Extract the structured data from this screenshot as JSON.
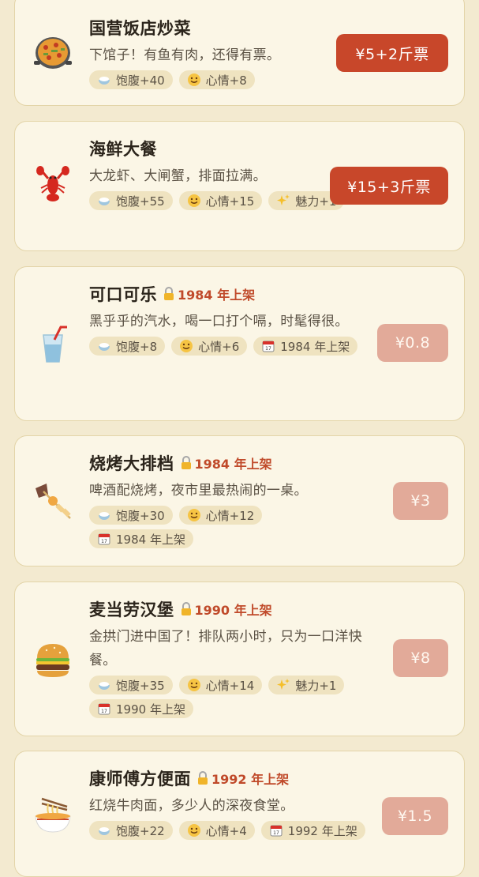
{
  "items": [
    {
      "name": "国营饭店炒菜",
      "icon": "paella-pan-icon",
      "desc": "下馆子！有鱼有肉，还得有票。",
      "tags": [
        {
          "icon": "rice-bowl-icon",
          "text": "饱腹+40"
        },
        {
          "icon": "smile-icon",
          "text": "心情+8"
        }
      ],
      "price": "¥5+2斤票",
      "locked": false
    },
    {
      "name": "海鲜大餐",
      "icon": "lobster-icon",
      "desc": "大龙虾、大闸蟹，排面拉满。",
      "tags": [
        {
          "icon": "rice-bowl-icon",
          "text": "饱腹+55"
        },
        {
          "icon": "smile-icon",
          "text": "心情+15"
        },
        {
          "icon": "sparkles-icon",
          "text": "魅力+1"
        }
      ],
      "price": "¥15+3斤票",
      "locked": false
    },
    {
      "name": "可口可乐",
      "icon": "cup-with-straw-icon",
      "year_tag": "1984 年上架",
      "desc": "黑乎乎的汽水，喝一口打个嗝，时髦得很。",
      "tags": [
        {
          "icon": "rice-bowl-icon",
          "text": "饱腹+8"
        },
        {
          "icon": "smile-icon",
          "text": "心情+6"
        },
        {
          "icon": "calendar-icon",
          "text": "1984 年上架"
        }
      ],
      "price": "¥0.8",
      "locked": true
    },
    {
      "name": "烧烤大排档",
      "icon": "skewer-icon",
      "year_tag": "1984 年上架",
      "desc": "啤酒配烧烤，夜市里最热闹的一桌。",
      "tags": [
        {
          "icon": "rice-bowl-icon",
          "text": "饱腹+30"
        },
        {
          "icon": "smile-icon",
          "text": "心情+12"
        },
        {
          "icon": "calendar-icon",
          "text": "1984 年上架"
        }
      ],
      "price": "¥3",
      "locked": true
    },
    {
      "name": "麦当劳汉堡",
      "icon": "hamburger-icon",
      "year_tag": "1990 年上架",
      "desc": "金拱门进中国了！排队两小时，只为一口洋快餐。",
      "tags": [
        {
          "icon": "rice-bowl-icon",
          "text": "饱腹+35"
        },
        {
          "icon": "smile-icon",
          "text": "心情+14"
        },
        {
          "icon": "sparkles-icon",
          "text": "魅力+1"
        },
        {
          "icon": "calendar-icon",
          "text": "1990 年上架"
        }
      ],
      "price": "¥8",
      "locked": true
    },
    {
      "name": "康师傅方便面",
      "icon": "noodle-bowl-icon",
      "year_tag": "1992 年上架",
      "desc": "红烧牛肉面，多少人的深夜食堂。",
      "tags": [
        {
          "icon": "rice-bowl-icon",
          "text": "饱腹+22"
        },
        {
          "icon": "smile-icon",
          "text": "心情+4"
        },
        {
          "icon": "calendar-icon",
          "text": "1992 年上架"
        }
      ],
      "price": "¥1.5",
      "locked": true
    }
  ],
  "colors": {
    "background": "#f3ead0",
    "card": "#fbf6e6",
    "accent": "#c8472a",
    "locked_button": "#e2aa99",
    "year_tag": "#c04a2a"
  }
}
